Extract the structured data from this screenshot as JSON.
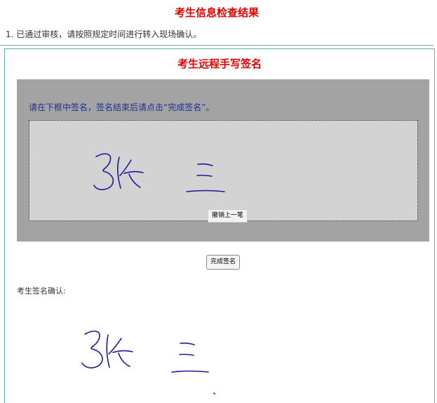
{
  "check_result": {
    "title": "考生信息检查结果",
    "notice": "1. 已通过审核，请按照规定时间进行转入现场确认。"
  },
  "signature": {
    "title": "考生远程手写签名",
    "instruction": "请在下框中签名，签名结束后请点击“完成签名”。",
    "undo_label": "撤销上一笔",
    "finish_label": "完成签名",
    "confirm_label": "考生签名确认:"
  },
  "colors": {
    "title_red": "#e50000",
    "instruction_blue": "#1e2f8c",
    "ink": "#1a1a9a",
    "border_teal": "#5fb3a9",
    "sign_area_gray": "#a3a3a3",
    "canvas_gray": "#d3d3d3"
  }
}
